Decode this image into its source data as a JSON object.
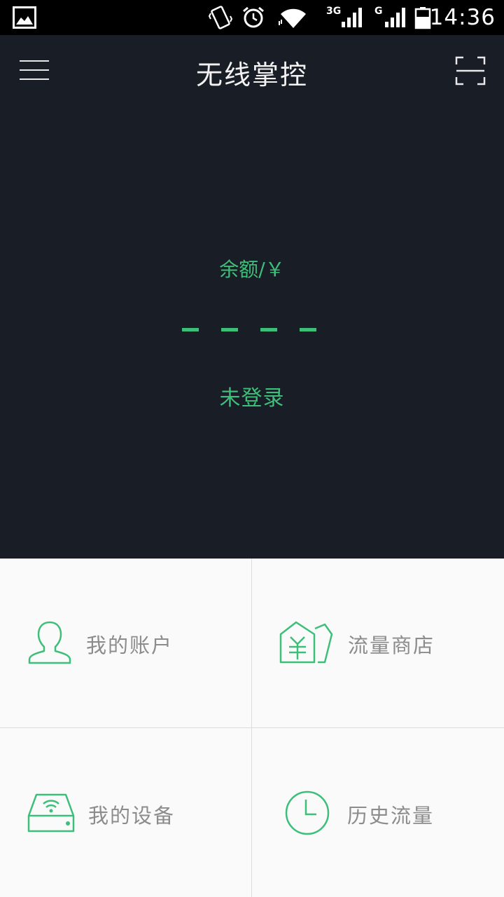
{
  "status_bar": {
    "time": "14:36",
    "network_1": "3G",
    "network_2": "G",
    "icons": [
      "gallery-icon",
      "vibrate-icon",
      "alarm-icon",
      "wifi-icon",
      "signal-3g-icon",
      "signal-g-icon",
      "battery-icon"
    ]
  },
  "header": {
    "title": "无线掌控",
    "menu_icon": "hamburger-menu-icon",
    "scan_icon": "scan-icon"
  },
  "balance": {
    "label": "余额/￥",
    "value": "----",
    "login_status": "未登录"
  },
  "grid": {
    "items": [
      {
        "label": "我的账户",
        "icon": "account-icon"
      },
      {
        "label": "流量商店",
        "icon": "store-icon"
      },
      {
        "label": "我的设备",
        "icon": "router-icon"
      },
      {
        "label": "历史流量",
        "icon": "clock-icon"
      }
    ]
  },
  "colors": {
    "accent": "#3dbf7a",
    "header_bg": "#191d26",
    "status_bar_bg": "#000000",
    "grid_bg": "#fafafa",
    "grid_label": "#8c8c8c",
    "divider": "#dcdcdc"
  }
}
